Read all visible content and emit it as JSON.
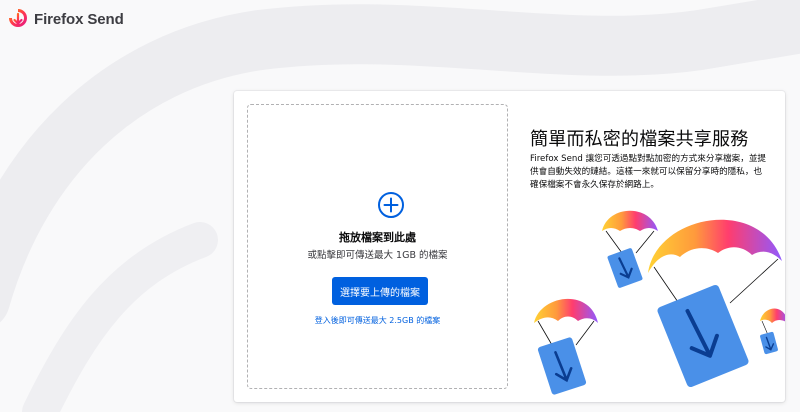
{
  "header": {
    "brand": "Firefox Send",
    "logo_icon": "firefox-send-logo-icon"
  },
  "upload": {
    "plus_icon": "plus-circle-icon",
    "title": "拖放檔案到此處",
    "subtitle": "或點擊即可傳送最大 1GB 的檔案",
    "button_label": "選擇要上傳的檔案",
    "signin_link": "登入後即可傳送最大 2.5GB 的檔案"
  },
  "intro": {
    "title": "簡單而私密的檔案共享服務",
    "description": "Firefox Send 讓您可透過點對點加密的方式來分享檔案，並提供會自動失效的鏈結。這樣一來就可以保留分享時的隱私，也確保檔案不會永久保存於網路上。"
  },
  "illustration": {
    "name": "parachute-files-illustration"
  },
  "colors": {
    "accent": "#0060df",
    "file_blue": "#4a90e8",
    "parachute_yellow": "#ffd234",
    "parachute_pink": "#ff3d6e",
    "parachute_purple": "#9059ff"
  }
}
